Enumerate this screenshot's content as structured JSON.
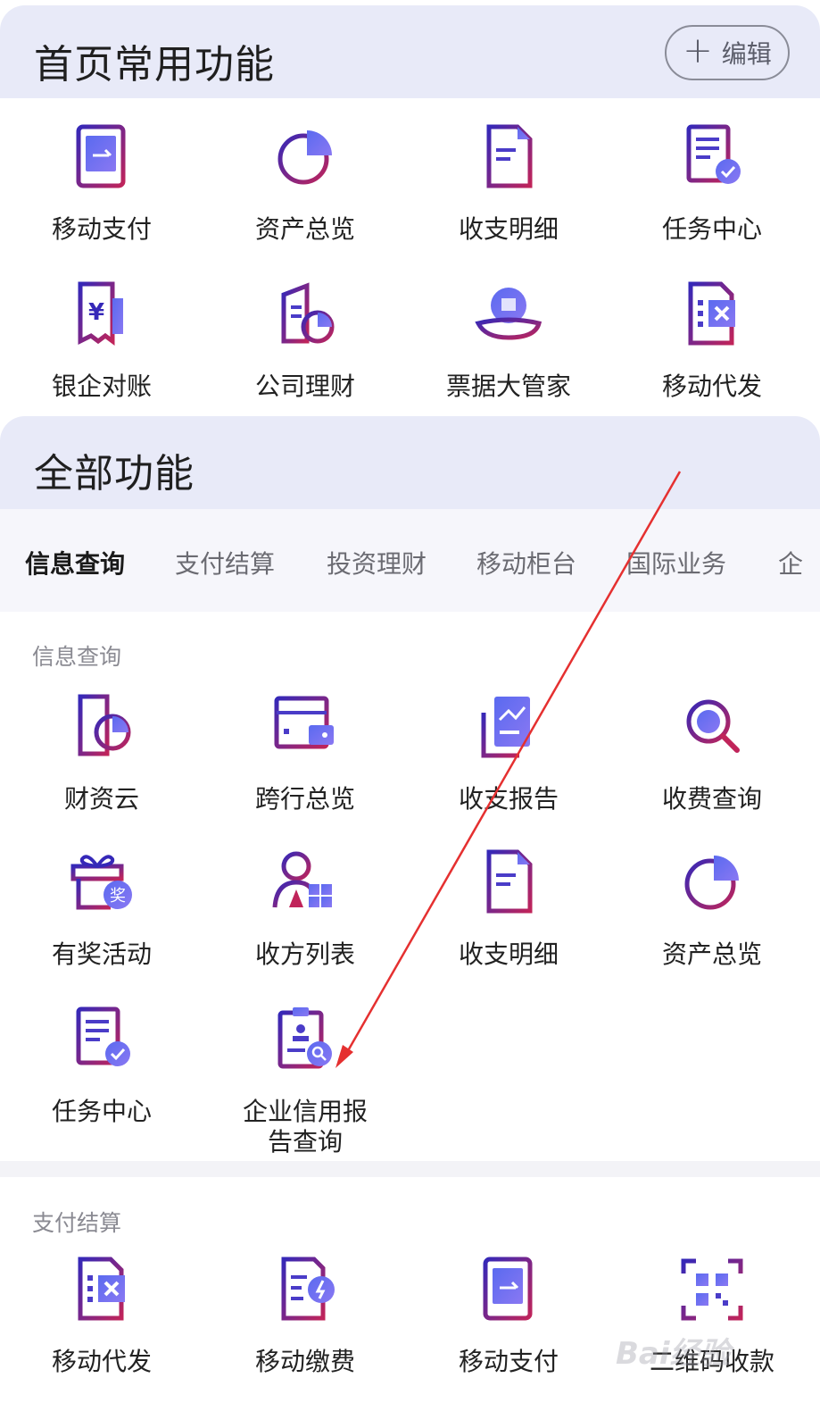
{
  "common": {
    "title": "首页常用功能",
    "edit_label": "编辑",
    "items": [
      {
        "label": "移动支付",
        "icon": "mobile-pay-icon"
      },
      {
        "label": "资产总览",
        "icon": "asset-overview-icon"
      },
      {
        "label": "收支明细",
        "icon": "income-expense-detail-icon"
      },
      {
        "label": "任务中心",
        "icon": "task-center-icon"
      },
      {
        "label": "银企对账",
        "icon": "bank-reconciliation-icon"
      },
      {
        "label": "公司理财",
        "icon": "company-finance-icon"
      },
      {
        "label": "票据大管家",
        "icon": "bill-manager-icon"
      },
      {
        "label": "移动代发",
        "icon": "mobile-disbursement-icon"
      }
    ]
  },
  "all": {
    "title": "全部功能",
    "tabs": [
      "信息查询",
      "支付结算",
      "投资理财",
      "移动柜台",
      "国际业务",
      "企"
    ],
    "active_tab": "信息查询",
    "info_section": {
      "title": "信息查询",
      "items": [
        {
          "label": "财资云",
          "icon": "treasury-cloud-icon"
        },
        {
          "label": "跨行总览",
          "icon": "cross-bank-overview-icon"
        },
        {
          "label": "收支报告",
          "icon": "income-expense-report-icon"
        },
        {
          "label": "收费查询",
          "icon": "fee-query-icon"
        },
        {
          "label": "有奖活动",
          "icon": "reward-activity-icon"
        },
        {
          "label": "收方列表",
          "icon": "payee-list-icon"
        },
        {
          "label": "收支明细",
          "icon": "income-expense-detail-icon"
        },
        {
          "label": "资产总览",
          "icon": "asset-overview-icon"
        },
        {
          "label": "任务中心",
          "icon": "task-center-icon"
        },
        {
          "label": "企业信用报\n告查询",
          "icon": "credit-report-icon"
        }
      ]
    },
    "pay_section": {
      "title": "支付结算",
      "items": [
        {
          "label": "移动代发",
          "icon": "mobile-disbursement-icon"
        },
        {
          "label": "移动缴费",
          "icon": "mobile-payment-fee-icon"
        },
        {
          "label": "移动支付",
          "icon": "mobile-pay-icon"
        },
        {
          "label": "二维码收款",
          "icon": "qr-collection-icon"
        }
      ]
    }
  },
  "watermark": "Bai经验",
  "colors": {
    "accent": "#3b2bb8",
    "accent2": "#c0245a",
    "header_bg": "#e8eaf8",
    "arrow": "#e53030"
  }
}
